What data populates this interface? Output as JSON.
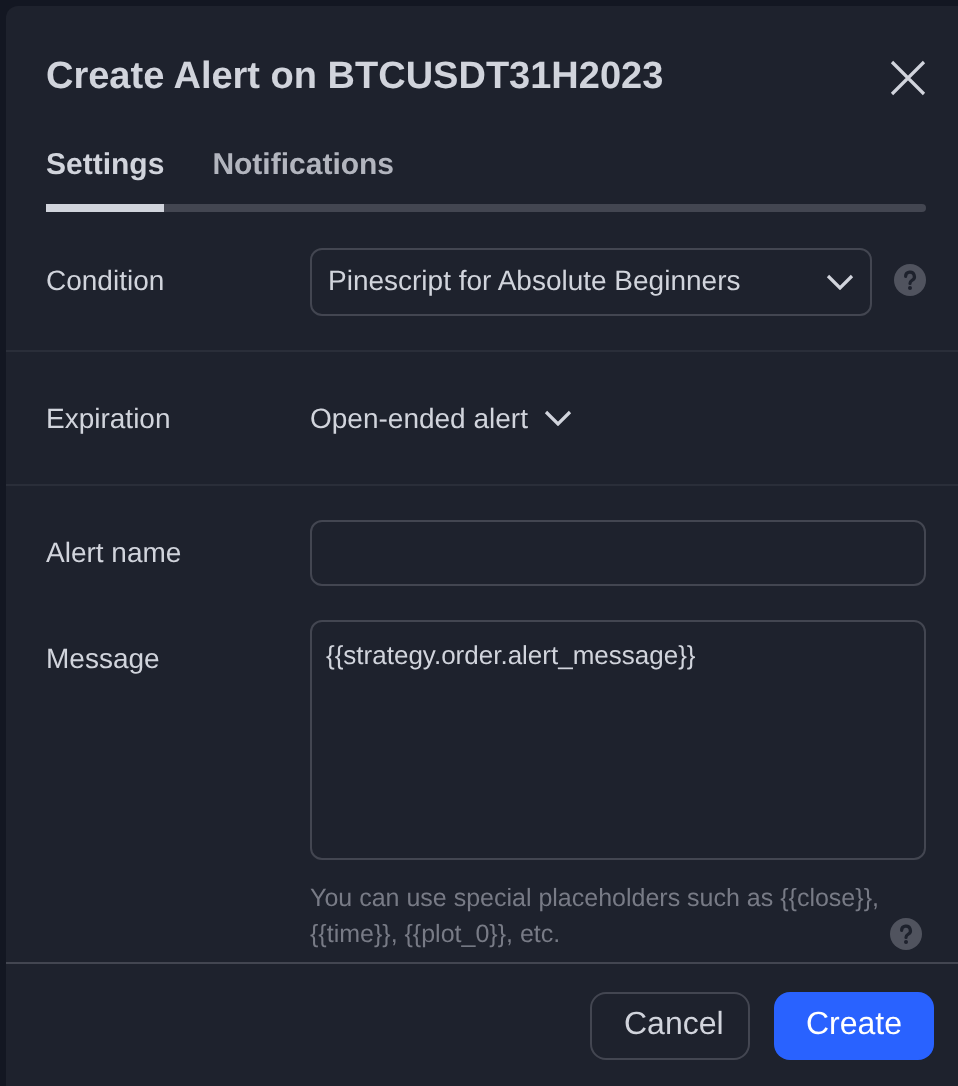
{
  "dialog": {
    "title": "Create Alert on BTCUSDT31H2023"
  },
  "tabs": [
    {
      "label": "Settings",
      "selected": true
    },
    {
      "label": "Notifications",
      "selected": false
    }
  ],
  "condition": {
    "label": "Condition",
    "value": "Pinescript for Absolute Beginners"
  },
  "expiration": {
    "label": "Expiration",
    "value": "Open-ended alert"
  },
  "alert_name": {
    "label": "Alert name"
  },
  "message": {
    "label": "Message",
    "value": "{{strategy.order.alert_message}}",
    "hint": "You can use special placeholders such as {{close}}, {{time}}, {{plot_0}}, etc."
  },
  "buttons": [
    {
      "label": "Cancel",
      "kind": "secondary"
    },
    {
      "label": "Create",
      "kind": "primary"
    }
  ]
}
